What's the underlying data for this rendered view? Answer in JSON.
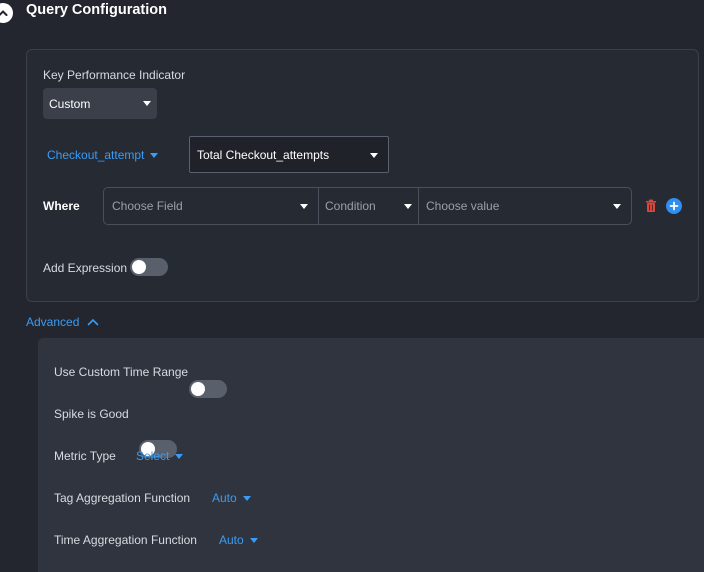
{
  "header": {
    "title": "Query Configuration"
  },
  "kpi": {
    "label": "Key Performance Indicator",
    "value": "Custom"
  },
  "metric": {
    "name": "Checkout_attempt",
    "aggregation": "Total Checkout_attempts"
  },
  "where": {
    "label": "Where",
    "field_placeholder": "Choose Field",
    "condition_placeholder": "Condition",
    "value_placeholder": "Choose value"
  },
  "add_expression": {
    "label": "Add Expression",
    "enabled": false
  },
  "advanced": {
    "label": "Advanced",
    "custom_time_range": {
      "label": "Use Custom Time Range",
      "enabled": false
    },
    "spike_is_good": {
      "label": "Spike is Good",
      "enabled": false
    },
    "metric_type": {
      "label": "Metric Type",
      "value": "Select"
    },
    "tag_aggregation": {
      "label": "Tag Aggregation Function",
      "value": "Auto"
    },
    "time_aggregation": {
      "label": "Time Aggregation Function",
      "value": "Auto"
    }
  },
  "colors": {
    "accent": "#3a9cf5",
    "danger": "#e0453a",
    "background": "#23262e"
  },
  "icons": [
    "chevron-up-icon",
    "caret-down-icon",
    "trash-icon",
    "plus-circle-icon"
  ]
}
